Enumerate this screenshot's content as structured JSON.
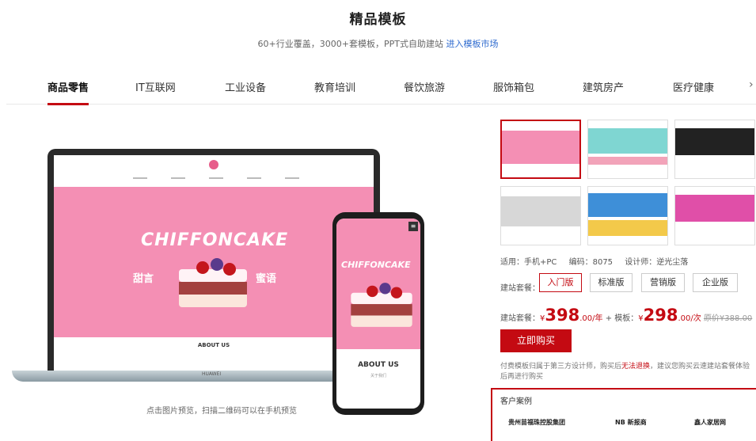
{
  "header": {
    "title": "精品模板",
    "subtitle": "60+行业覆盖，3000+套模板，PPT式自助建站",
    "market_link": "进入模板市场"
  },
  "tabs": [
    "商品零售",
    "IT互联网",
    "工业设备",
    "教育培训",
    "餐饮旅游",
    "服饰箱包",
    "建筑房产",
    "医疗健康"
  ],
  "active_tab": "商品零售",
  "tab_next": "›",
  "preview": {
    "laptop_screen_title": "CHIFFONCAKE",
    "left_slogan": "甜言",
    "right_slogan": "蜜语",
    "about_title": "ABOUT US",
    "about_sub": "关于我们",
    "laptop_brand": "HUAWEI",
    "caption": "点击图片预览，扫描二维码可以在手机预览"
  },
  "template_info": {
    "adapt": "适用：手机+PC",
    "code": "编码：8075",
    "designer": "设计师：逆光尘落"
  },
  "packages": {
    "label": "建站套餐：",
    "options": [
      "入门版",
      "标准版",
      "营销版",
      "企业版"
    ],
    "selected": "入门版"
  },
  "pricing": {
    "label": "建站套餐：",
    "price": "398",
    "price_unit": ".00/年",
    "plus": "+ 模板：",
    "template_price": "298",
    "template_unit": ".00/次",
    "original": "原价¥388.00",
    "currency": "¥"
  },
  "buy_button": "立即购买",
  "note": {
    "before": "付费模板归属于第三方设计师，购买后",
    "warn": "无法退换",
    "after": "，建议您购买云速建站套餐体验后再进行购买"
  },
  "cases": {
    "title": "客户案例",
    "logos": [
      "贵州苗福珠控股集团",
      "NB 新报商",
      "鑫人家居网"
    ]
  },
  "colors": {
    "accent": "#c40a12",
    "pink": "#f48fb4",
    "link": "#2f6bcf"
  }
}
